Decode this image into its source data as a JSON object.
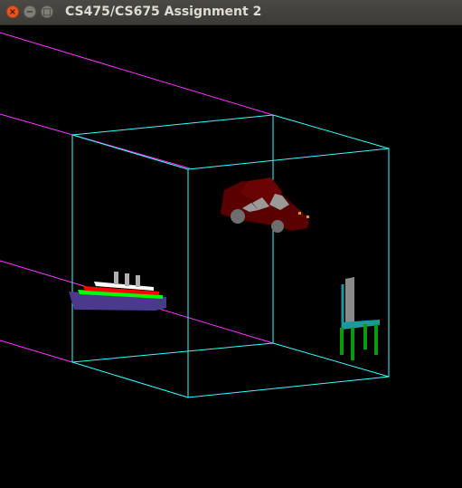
{
  "window": {
    "title": "CS475/CS675 Assignment 2",
    "buttons": {
      "close": "×",
      "minimize": "−",
      "maximize": "□"
    }
  },
  "scene": {
    "background_color": "#000000",
    "frustum_lines_color": "#ff33ff",
    "box_color": "#33ffff",
    "objects": [
      {
        "name": "car",
        "body_color": "#5a0000",
        "window_color": "#9a9a9a",
        "wheel_color": "#6e6e6e"
      },
      {
        "name": "ship",
        "hull_color": "#4b3a8c",
        "stripe_colors": [
          "#00ff00",
          "#ff0000",
          "#ffffff"
        ],
        "chimney_color": "#b0b0b0"
      },
      {
        "name": "chair",
        "back_color": "#8a8a8a",
        "frame_color": "#1a9a9a",
        "leg_color": "#0a9a0a"
      }
    ]
  }
}
